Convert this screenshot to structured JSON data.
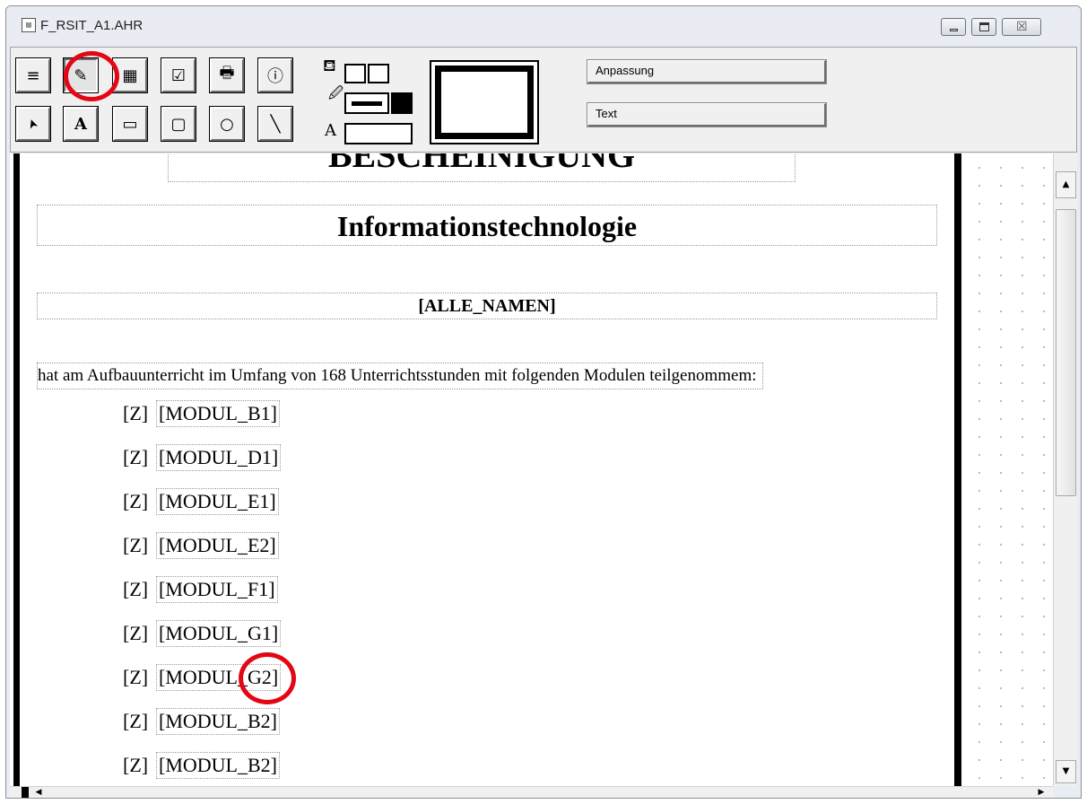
{
  "window": {
    "title": "F_RSIT_A1.AHR",
    "app_icon": "document-icon"
  },
  "caption_buttons": {
    "minimize": "minimize-icon",
    "maximize": "maximize-icon",
    "close": "close-icon",
    "close_glyph": "☒"
  },
  "toolbar": {
    "row1": [
      {
        "name": "menu-lines-button",
        "glyph": "≡"
      },
      {
        "name": "pencil-edit-button",
        "glyph": "✎"
      },
      {
        "name": "table-button",
        "glyph": "▦"
      },
      {
        "name": "checklist-button",
        "glyph": "☑"
      },
      {
        "name": "print-button",
        "glyph": "🖶"
      },
      {
        "name": "info-button",
        "glyph": "ⓘ"
      }
    ],
    "row2": [
      {
        "name": "select-arrow-tool",
        "glyph": "➤"
      },
      {
        "name": "text-tool",
        "glyph": "A"
      },
      {
        "name": "rectangle-tool",
        "glyph": "▭"
      },
      {
        "name": "rounded-rect-tool",
        "glyph": "▢"
      },
      {
        "name": "ellipse-tool",
        "glyph": "○"
      },
      {
        "name": "line-tool",
        "glyph": "╲"
      }
    ],
    "fill_icon": "⛾",
    "pen_icon": "🖉",
    "text_color_letter": "A",
    "buttons": {
      "adjust": "Anpassung",
      "text": "Text"
    }
  },
  "document": {
    "heading_1": "BESCHEINIGUNG",
    "heading_2": "Informationstechnologie",
    "names_field": "[ALLE_NAMEN]",
    "intro": "hat am Aufbauunterricht im Umfang von 168 Unterrichtsstunden mit folgenden Modulen teilgenommem:",
    "z_label": "[Z]",
    "modules": [
      "[MODUL_B1]",
      "[MODUL_D1]",
      "[MODUL_E1]",
      "[MODUL_E2]",
      "[MODUL_F1]",
      "[MODUL_G1]",
      "[MODUL_G2]",
      "[MODUL_B2]",
      "[MODUL_B2]"
    ]
  },
  "scrollbars": {
    "up": "▲",
    "down": "▼",
    "left": "◀",
    "right": "▶"
  },
  "colors": {
    "annotation": "#e30613"
  }
}
